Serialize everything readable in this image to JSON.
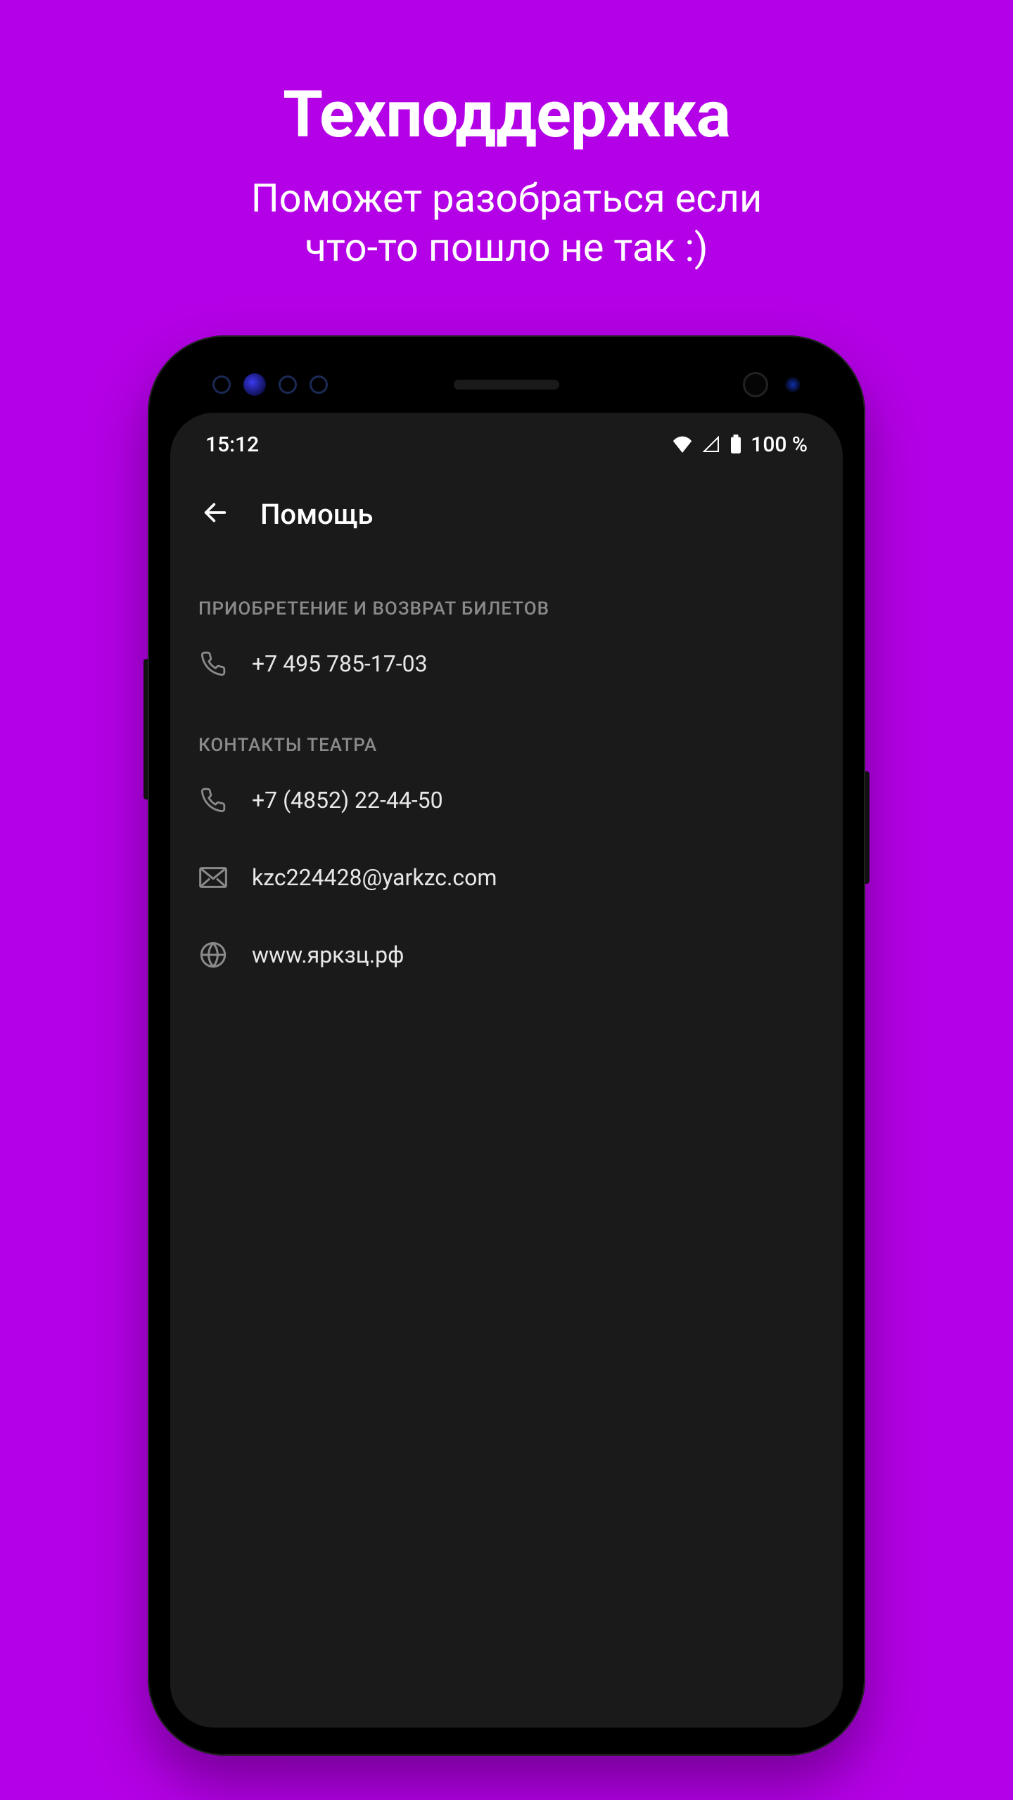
{
  "promo": {
    "title": "Техподдержка",
    "subtitle_line1": "Поможет разобраться если",
    "subtitle_line2": "что-то пошло не так :)"
  },
  "status_bar": {
    "time": "15:12",
    "battery_text": "100 %"
  },
  "app_bar": {
    "title": "Помощь"
  },
  "sections": {
    "tickets": {
      "header": "ПРИОБРЕТЕНИЕ И ВОЗВРАТ БИЛЕТОВ",
      "phone": "+7 495 785-17-03"
    },
    "theatre": {
      "header": "КОНТАКТЫ ТЕАТРА",
      "phone": "+7 (4852) 22-44-50",
      "email": "kzc224428@yarkzc.com",
      "website": "www.яркзц.рф"
    }
  }
}
